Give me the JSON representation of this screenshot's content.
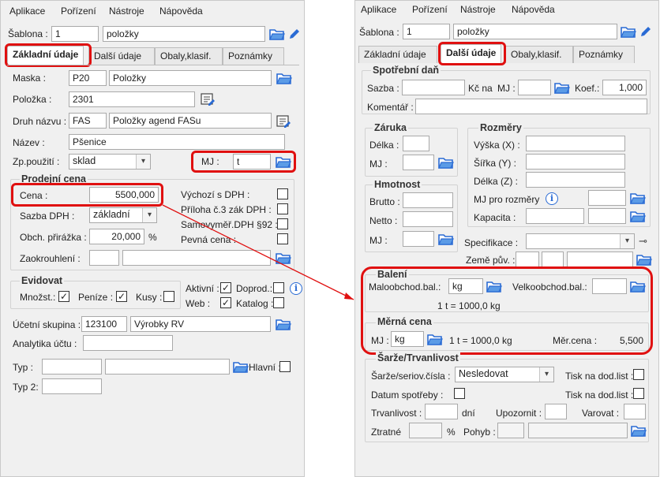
{
  "colors": {
    "highlight": "#e01010",
    "folder": "#2a6bd4",
    "panel_bg": "#f0f0f0"
  },
  "menu": [
    "Aplikace",
    "Pořízení",
    "Nástroje",
    "Nápověda"
  ],
  "sablona": {
    "label": "Šablona :",
    "num": "1",
    "name": "položky"
  },
  "tabs": [
    "Základní údaje",
    "Další údaje",
    "Obaly,klasif.",
    "Poznámky"
  ],
  "left": {
    "maska": {
      "label": "Maska :",
      "code": "P20",
      "name": "Položky"
    },
    "polozka": {
      "label": "Položka :",
      "value": "2301"
    },
    "druh": {
      "label": "Druh názvu :",
      "code": "FAS",
      "name": "Položky agend FASu"
    },
    "nazev": {
      "label": "Název :",
      "value": "Pšenice"
    },
    "zp": {
      "label": "Zp.použití :",
      "value": "sklad"
    },
    "mj": {
      "label": "MJ :",
      "value": "t"
    },
    "prodejni": {
      "title": "Prodejní cena",
      "cena_label": "Cena :",
      "cena_value": "5500,000",
      "sazba_label": "Sazba DPH :",
      "sazba_value": "základní",
      "obch_label": "Obch. přirážka :",
      "obch_value": "20,000",
      "obch_unit": "%",
      "zaokr_label": "Zaokrouhlení :",
      "chk_vychozi": "Výchozí s DPH :",
      "chk_priloha": "Příloha č.3 zák DPH :",
      "chk_samo": "Samovyměř.DPH §92 :",
      "chk_pevna": "Pevná cena :"
    },
    "evidovat": {
      "title": "Evidovat",
      "mnozst": "Množst.:",
      "penize": "Peníze :",
      "kusy": "Kusy :",
      "aktivni": "Aktivní :",
      "doprod": "Doprod.:",
      "web": "Web :",
      "katalog": "Katalog :"
    },
    "ucetni": {
      "label": "Účetní skupina :",
      "code": "123100",
      "name": "Výrobky RV"
    },
    "analytika": {
      "label": "Analytika účtu :"
    },
    "typ": {
      "label": "Typ :",
      "hlavni": "Hlavní :"
    },
    "typ2": {
      "label": "Typ 2:"
    }
  },
  "right": {
    "spotrebni": {
      "title": "Spotřební daň",
      "sazba": "Sazba :",
      "kcna": "Kč na",
      "mj": "MJ :",
      "koef": "Koef.:",
      "koef_value": "1,000",
      "komentar": "Komentář :"
    },
    "zaruka": {
      "title": "Záruka",
      "delka": "Délka :",
      "mj": "MJ :"
    },
    "hmotnost": {
      "title": "Hmotnost",
      "brutto": "Brutto :",
      "netto": "Netto :",
      "mj": "MJ :"
    },
    "rozmery": {
      "title": "Rozměry",
      "vyska": "Výška (X) :",
      "sirka": "Šířka (Y) :",
      "delka": "Délka (Z) :",
      "mj_pro": "MJ pro rozměry",
      "kapacita": "Kapacita :"
    },
    "specifikace": "Specifikace :",
    "zeme": "Země pův. :",
    "baleni": {
      "title": "Balení",
      "malo": "Maloobchod.bal.:",
      "malo_value": "kg",
      "velko": "Velkoobchod.bal.:",
      "conv": "1 t = 1000,0 kg"
    },
    "merna": {
      "title": "Měrná cena",
      "mj": "MJ :",
      "mj_value": "kg",
      "conv": "1 t = 1000,0 kg",
      "mer_label": "Měr.cena :",
      "mer_value": "5,500"
    },
    "sarze": {
      "title": "Šarže/Trvanlivost",
      "label": "Šarže/seriov.čísla :",
      "value": "Nesledovat",
      "tisk1": "Tisk na dod.list :",
      "datum": "Datum spotřeby :",
      "tisk2": "Tisk na dod.list :",
      "trvan": "Trvanlivost :",
      "dni": "dní",
      "upoz": "Upozornit :",
      "varovat": "Varovat :",
      "ztratne": "Ztratné",
      "pct": "%",
      "pohyb": "Pohyb :"
    }
  }
}
